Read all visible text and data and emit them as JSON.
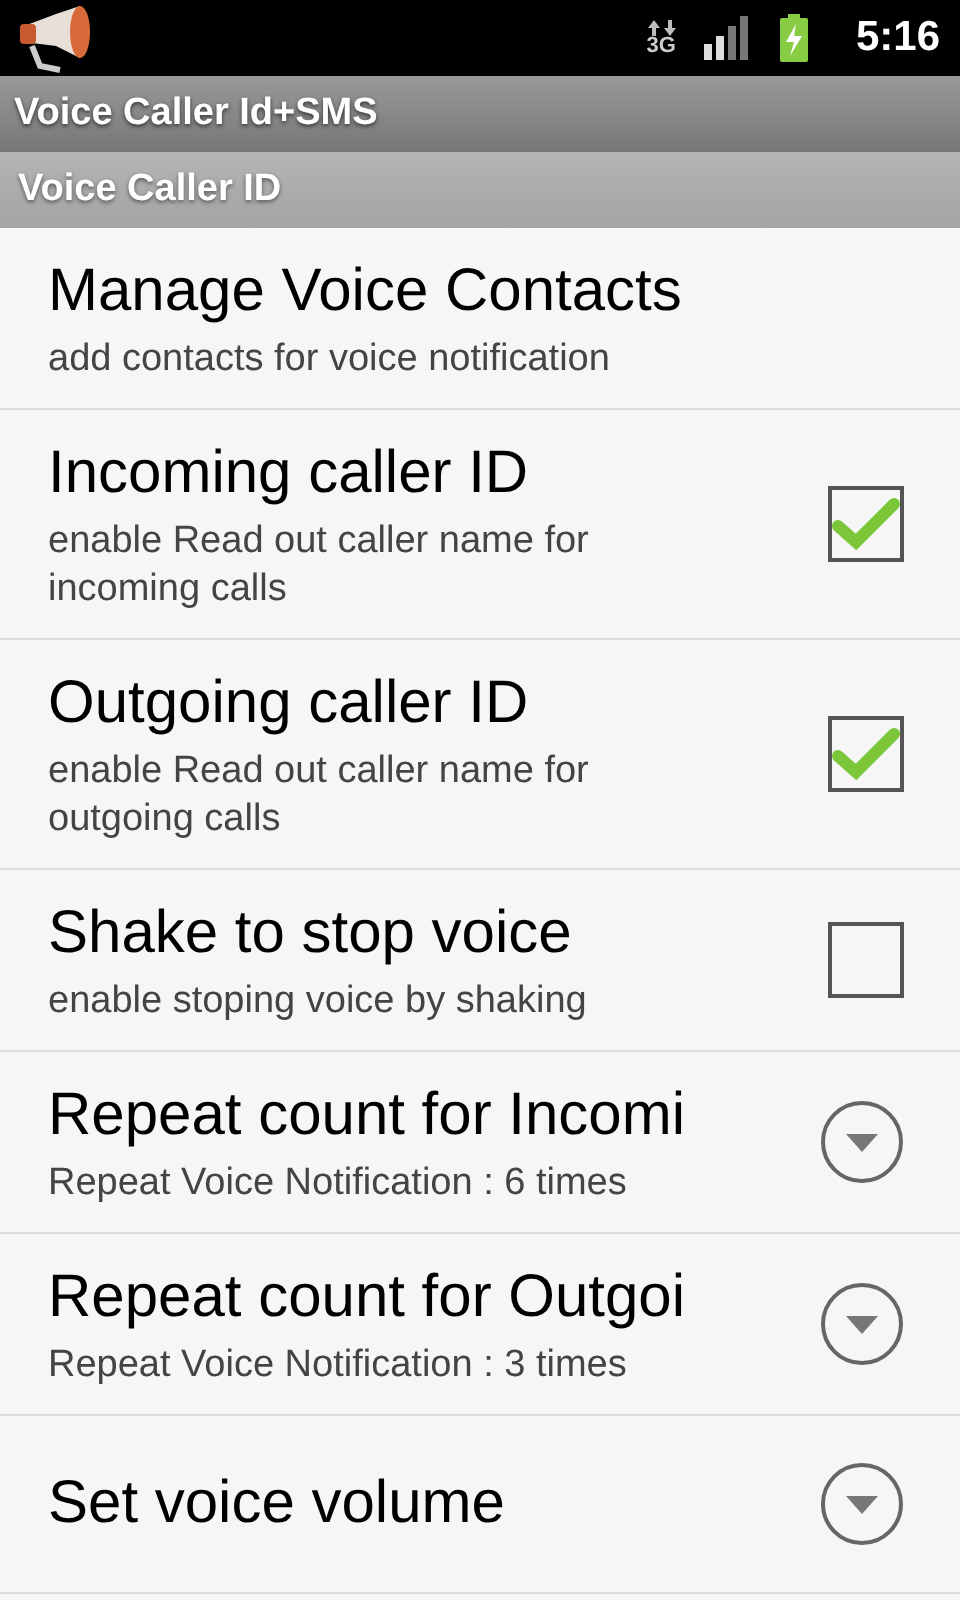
{
  "status_bar": {
    "network": "3G",
    "time": "5:16"
  },
  "app_bar": {
    "title": "Voice Caller Id+SMS"
  },
  "section": {
    "title": "Voice Caller ID"
  },
  "preferences": [
    {
      "kind": "plain",
      "title": "Manage Voice Contacts",
      "summary": "add contacts for voice notification"
    },
    {
      "kind": "checkbox",
      "title": "Incoming caller ID",
      "summary": "enable Read out caller name for incoming calls",
      "checked": true
    },
    {
      "kind": "checkbox",
      "title": "Outgoing caller ID",
      "summary": "enable Read out caller name for outgoing calls",
      "checked": true
    },
    {
      "kind": "checkbox",
      "title": "Shake to stop voice",
      "summary": "enable stoping voice by shaking",
      "checked": false
    },
    {
      "kind": "dropdown",
      "title": "Repeat count for Incomi",
      "summary": "Repeat Voice Notification : 6 times"
    },
    {
      "kind": "dropdown",
      "title": "Repeat count for Outgoi",
      "summary": "Repeat Voice Notification : 3 times"
    },
    {
      "kind": "dropdown",
      "title": "Set voice volume"
    }
  ]
}
